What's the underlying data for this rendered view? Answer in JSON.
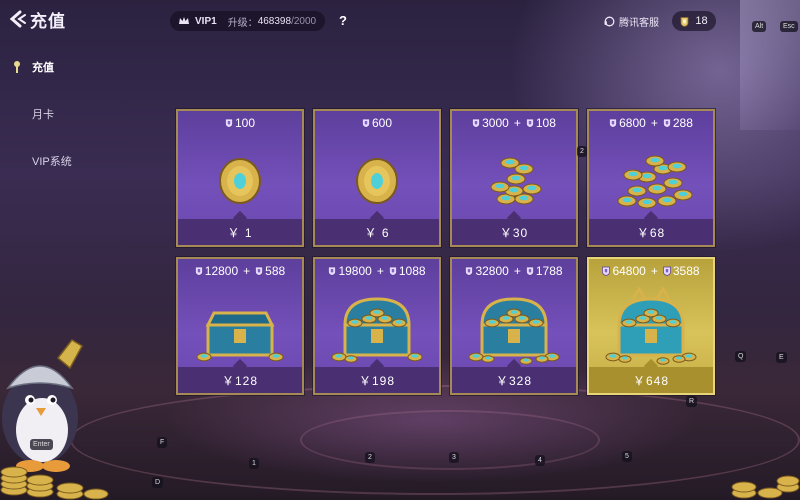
{
  "header": {
    "back_title": "充值",
    "vip_label": "VIP1",
    "level_label": "升级：",
    "level_current": "468398",
    "level_max": "/2000",
    "help_label": "?",
    "service_label": "腾讯客服",
    "coin_balance": "18"
  },
  "key_hints": {
    "alt": "Alt",
    "esc": "Esc",
    "enter": "Enter",
    "f": "F",
    "d": "D",
    "q": "Q",
    "e": "E",
    "r": "R",
    "n1": "1",
    "n2": "2",
    "n3": "3",
    "n4": "4",
    "n5": "5",
    "n2b": "2"
  },
  "sidebar": {
    "items": [
      {
        "label": "充值",
        "active": true
      },
      {
        "label": "月卡",
        "active": false
      },
      {
        "label": "VIP系统",
        "active": false
      }
    ]
  },
  "packs": [
    {
      "base": "100",
      "bonus": "",
      "price": "￥ 1",
      "art": "coin-single-icon",
      "highlight": false
    },
    {
      "base": "600",
      "bonus": "",
      "price": "￥ 6",
      "art": "coin-single-icon",
      "highlight": false
    },
    {
      "base": "3000",
      "bonus": "108",
      "price": "￥30",
      "art": "coin-stack-small-icon",
      "highlight": false
    },
    {
      "base": "6800",
      "bonus": "288",
      "price": "￥68",
      "art": "coin-stack-large-icon",
      "highlight": false
    },
    {
      "base": "12800",
      "bonus": "588",
      "price": "￥128",
      "art": "chest-open-icon",
      "highlight": false
    },
    {
      "base": "19800",
      "bonus": "1088",
      "price": "￥198",
      "art": "chest-full-icon",
      "highlight": false
    },
    {
      "base": "32800",
      "bonus": "1788",
      "price": "￥328",
      "art": "chest-overflow-icon",
      "highlight": false
    },
    {
      "base": "64800",
      "bonus": "3588",
      "price": "￥648",
      "art": "chest-gold-icon",
      "highlight": true
    }
  ],
  "colors": {
    "card_purple": "#7450ba",
    "card_gold": "#d8c35a",
    "border_gold": "#a68a55"
  }
}
